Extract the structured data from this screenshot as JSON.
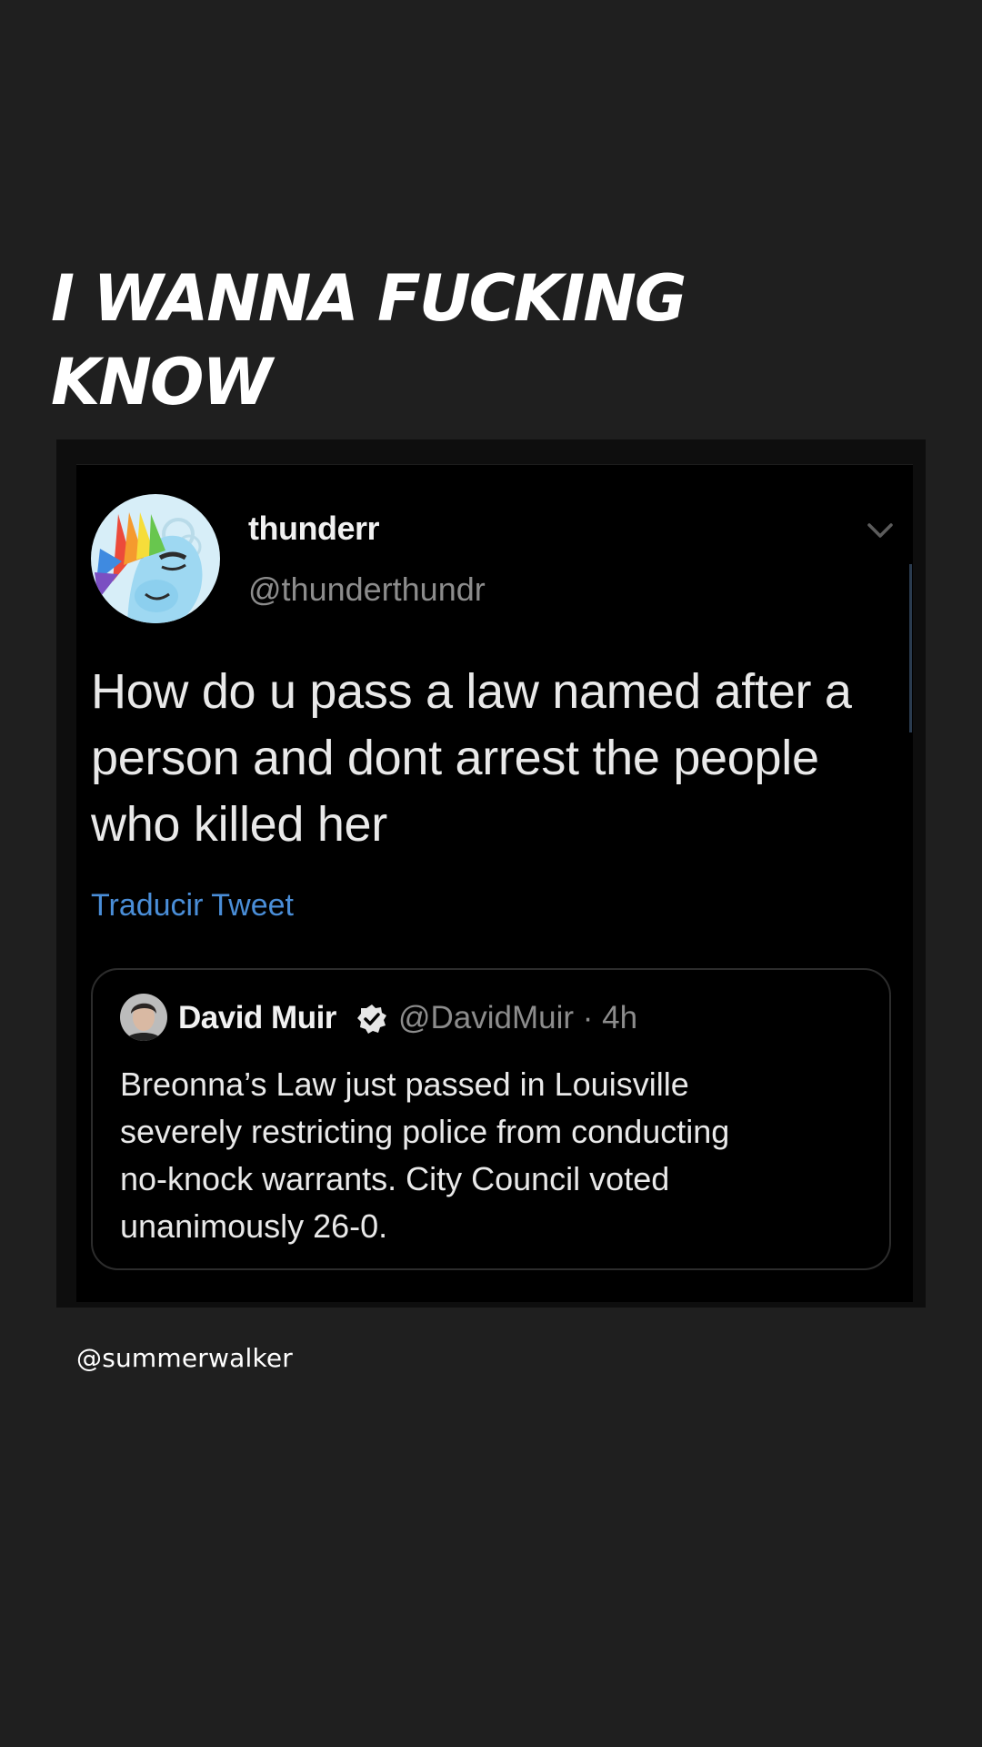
{
  "story": {
    "caption_line1": "I WANNA FUCKING",
    "caption_line2": "KNOW",
    "mention": "@summerwalker"
  },
  "tweet": {
    "display_name": "thunderr",
    "handle": "@thunderthundr",
    "text": "How do u pass a law named after a person and dont arrest the people who killed her",
    "translate_link": "Traducir Tweet",
    "avatar_icon": "rainbow-pony-avatar-icon",
    "menu_icon": "chevron-down-icon"
  },
  "quoted_tweet": {
    "display_name": "David Muir",
    "meta": "@DavidMuir · 4h",
    "text": "Breonna’s Law just passed in Louisville\nseverely restricting police from conducting\nno-knock warrants.  City Council voted\nunanimously 26-0.",
    "verified_icon": "verified-badge-icon",
    "avatar_icon": "profile-photo-avatar"
  },
  "colors": {
    "story_background": "#1f1f1f",
    "tweet_background": "#000000",
    "link_blue": "#4a8ed8",
    "secondary_text": "#8c8c8c"
  }
}
